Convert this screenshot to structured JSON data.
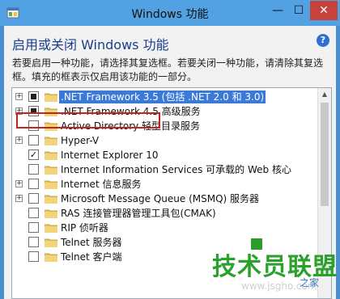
{
  "window": {
    "title": "Windows 功能",
    "min_glyph": "—",
    "max_glyph": "☐",
    "close_glyph": "✕"
  },
  "dialog": {
    "heading": "启用或关闭 Windows 功能",
    "help_glyph": "?",
    "description": "若要启用一种功能，请选择其复选框。若要关闭一种功能，请清除其复选框。填充的框表示仅启用该功能的一部分。"
  },
  "features": [
    {
      "label": ".NET Framework 3.5 (包括 .NET 2.0 和 3.0)",
      "state": "partial",
      "expandable": true,
      "selected": true
    },
    {
      "label": ".NET Framework 4.5 高级服务",
      "state": "partial",
      "expandable": true,
      "selected": false
    },
    {
      "label": "Active Directory 轻型目录服务",
      "state": "unchecked",
      "expandable": false,
      "selected": false
    },
    {
      "label": "Hyper-V",
      "state": "unchecked",
      "expandable": true,
      "selected": false
    },
    {
      "label": "Internet Explorer 10",
      "state": "checked",
      "expandable": false,
      "selected": false
    },
    {
      "label": "Internet Information Services 可承载的 Web 核心",
      "state": "unchecked",
      "expandable": false,
      "selected": false
    },
    {
      "label": "Internet 信息服务",
      "state": "unchecked",
      "expandable": true,
      "selected": false
    },
    {
      "label": "Microsoft Message Queue (MSMQ) 服务器",
      "state": "unchecked",
      "expandable": true,
      "selected": false
    },
    {
      "label": "RAS 连接管理器管理工具包(CMAK)",
      "state": "unchecked",
      "expandable": false,
      "selected": false
    },
    {
      "label": "RIP 侦听器",
      "state": "unchecked",
      "expandable": false,
      "selected": false
    },
    {
      "label": "Telnet 服务器",
      "state": "unchecked",
      "expandable": false,
      "selected": false
    },
    {
      "label": "Telnet 客户端",
      "state": "unchecked",
      "expandable": false,
      "selected": false
    }
  ],
  "watermark": {
    "title": "技术员联盟",
    "url": "www.jsgho.com",
    "sub": "之家"
  },
  "colors": {
    "titlebar": "#52a2e3",
    "selection": "#3a79d6",
    "highlight_box": "#c22424",
    "watermark_green": "#2aa12a"
  }
}
